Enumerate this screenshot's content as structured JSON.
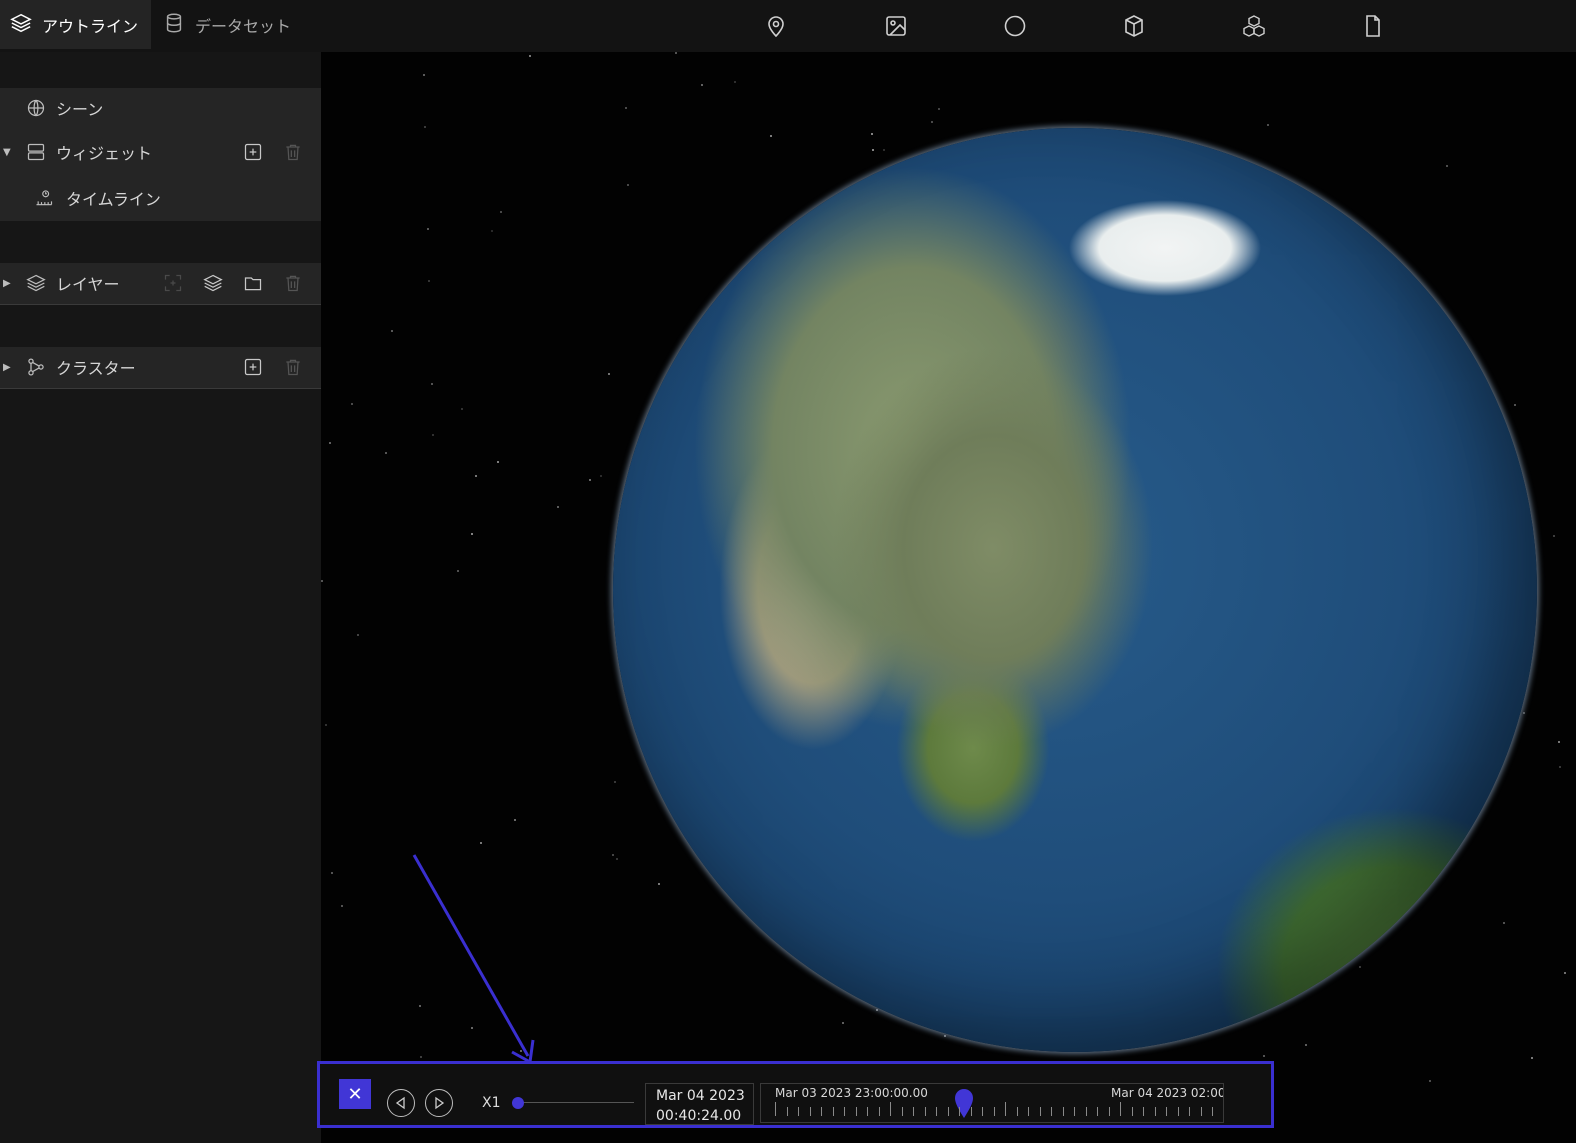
{
  "tabs": {
    "outline": "アウトライン",
    "dataset": "データセット"
  },
  "tools": [
    "marker-icon",
    "image-icon",
    "circle-icon",
    "box-icon",
    "cluster-3d-icon",
    "file-icon"
  ],
  "outline": {
    "scene": "シーン",
    "widgets": {
      "label": "ウィジェット",
      "items": [
        "タイムライン"
      ]
    },
    "layers": {
      "label": "レイヤー"
    },
    "clusters": {
      "label": "クラスター"
    }
  },
  "timeline": {
    "speed": "X1",
    "current_date": "Mar 04 2023",
    "current_time": "00:40:24.00",
    "range_start": "Mar 03 2023 23:00:00.00",
    "range_end": "Mar 04 2023 02:00:"
  },
  "colors": {
    "accent": "#3a2fd0",
    "panel": "#252525",
    "background": "#161616"
  }
}
